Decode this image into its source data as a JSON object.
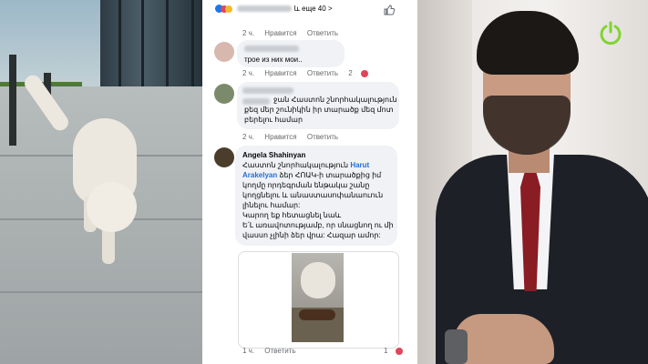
{
  "comments_panel": {
    "top_reaction": {
      "more_label": "և еще 40",
      "chevron": ">"
    },
    "comments": [
      {
        "time": "2 ч.",
        "like": "Нравится",
        "reply": "Ответить",
        "text": ""
      },
      {
        "time": "2 ч.",
        "like": "Нравится",
        "reply": "Ответить",
        "text": "трое из них мои..",
        "reactions": "2"
      },
      {
        "time": "2 ч.",
        "like": "Нравится",
        "reply": "Ответить",
        "lines": [
          "ջան Հաստոն շնորհակալություն",
          "քեզ մեր շունիկին իր տարածք մեզ մոտ",
          "բերելու համար"
        ]
      },
      {
        "author": "Angela Shahinyan",
        "line1": "Հաստոն շնորհակալություն",
        "mention_first": "Harut",
        "mention_second": "Arakelyan",
        "line2_rest": "ձեր ՀՈԱԿ-ի տարածքից իմ",
        "lines": [
          "կողմը որդեգրման ենթակա շանը",
          "կողցնելու և անաստասոփանաուուն",
          "լինելու համար:",
          "Կարող եք հետացնել նաև",
          "Ե՛Լ առավոտությամբ, որ սնացնող ու մի",
          "վասսո չլինի ձեր վրա: Հազար ամոր:"
        ],
        "time": "1 ч.",
        "reply": "Ответить",
        "reactions": "1"
      }
    ]
  },
  "colors": {
    "link": "#216fdb",
    "bubble": "#f0f2f5",
    "meta": "#65676b",
    "accent_green": "#7fd430"
  },
  "icons": {
    "top_reaction": "thumbs-up-icon",
    "emoji_heart": "heart-reaction-icon",
    "power": "power-icon"
  }
}
